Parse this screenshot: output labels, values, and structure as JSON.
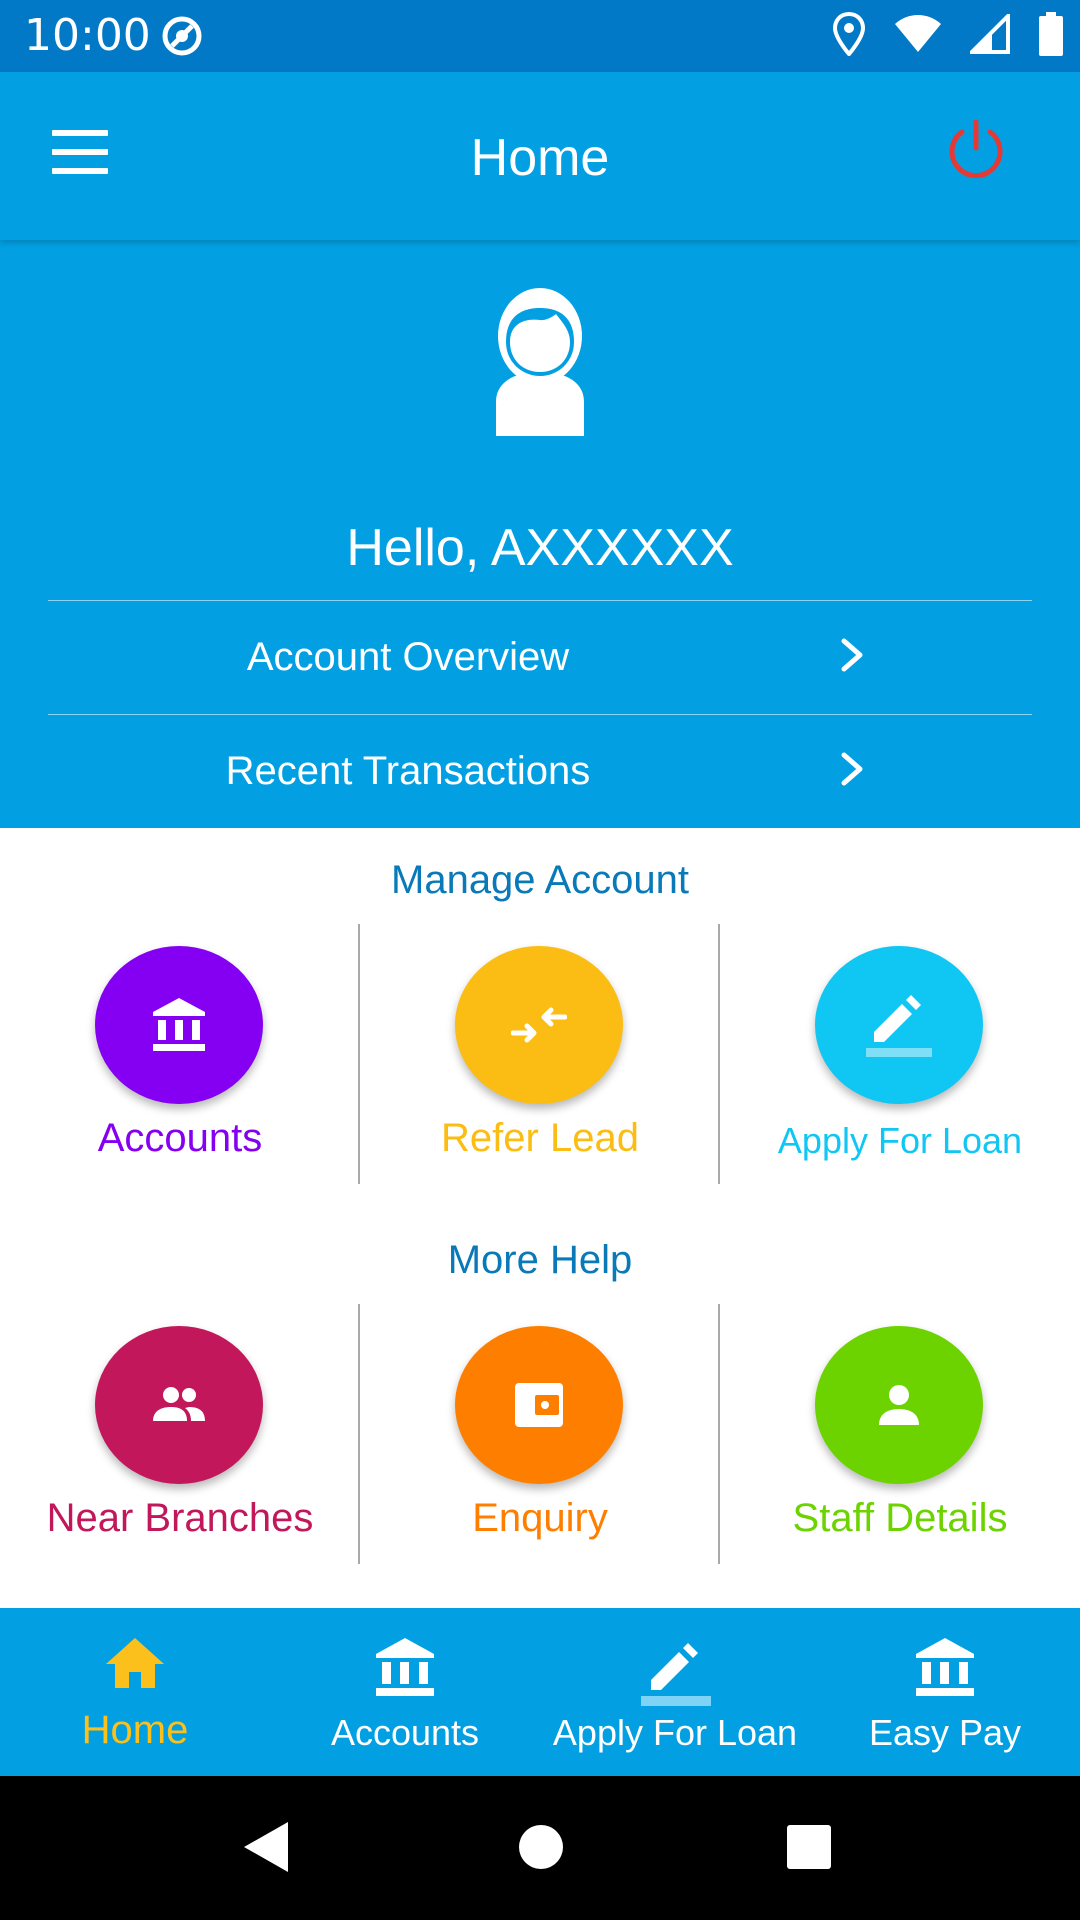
{
  "status_bar": {
    "time": "10:00",
    "icons": [
      "sync-icon",
      "location-icon",
      "wifi-icon",
      "signal-icon",
      "battery-icon"
    ]
  },
  "app_bar": {
    "title": "Home",
    "menu_icon": "hamburger-menu-icon",
    "power_icon": "power-icon",
    "power_color": "#e53935"
  },
  "profile": {
    "avatar_icon": "female-user-avatar-icon",
    "greeting": "Hello, AXXXXXX"
  },
  "quick_links": [
    {
      "label": "Account Overview",
      "icon": "chevron-right-icon"
    },
    {
      "label": "Recent Transactions",
      "icon": "chevron-right-icon"
    }
  ],
  "manage_account": {
    "title": "Manage Account",
    "items": [
      {
        "label": "Accounts",
        "icon": "bank-icon",
        "color": "#8500f2"
      },
      {
        "label": "Refer Lead",
        "icon": "transfer-arrows-icon",
        "color": "#fbbd13"
      },
      {
        "label": "Apply For Loan",
        "icon": "pencil-icon",
        "color": "#10c6f3"
      }
    ]
  },
  "more_help": {
    "title": "More Help",
    "items": [
      {
        "label": "Near Branches",
        "icon": "people-icon",
        "color": "#c2185b"
      },
      {
        "label": "Enquiry",
        "icon": "wallet-icon",
        "color": "#fe7f00"
      },
      {
        "label": "Staff Details",
        "icon": "person-icon",
        "color": "#6cd301"
      }
    ]
  },
  "bottom_nav": [
    {
      "label": "Home",
      "icon": "home-icon",
      "active": true
    },
    {
      "label": "Accounts",
      "icon": "bank-icon",
      "active": false
    },
    {
      "label": "Apply For Loan",
      "icon": "pencil-icon",
      "active": false
    },
    {
      "label": "Easy Pay",
      "icon": "bank-icon",
      "active": false
    }
  ],
  "theme": {
    "primary": "#02a0e3",
    "status_bar": "#0179c7",
    "section_title": "#0979b8",
    "active_nav": "#fbc01b"
  },
  "system_nav": [
    "back-icon",
    "home-circle-icon",
    "recents-icon"
  ]
}
